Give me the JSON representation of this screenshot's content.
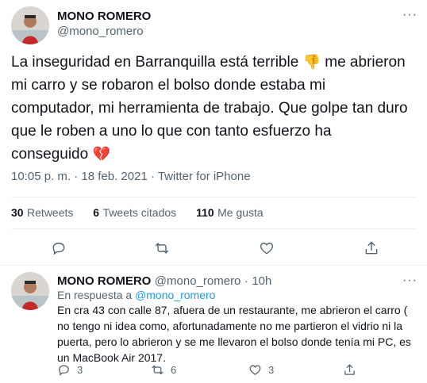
{
  "main_tweet": {
    "author_name": "MONO ROMERO",
    "author_handle": "@mono_romero",
    "text_part1": "La inseguridad en Barranquilla está terrible ",
    "emoji1": "👎",
    "text_part2": " me abrieron mi carro y se robaron el bolso donde estaba mi computador,  mi herramienta de trabajo. Que golpe tan duro que le roben a uno lo que con tanto esfuerzo ha conseguido ",
    "emoji2": "💔",
    "timestamp": "10:05 p. m. · 18 feb. 2021 · Twitter for iPhone",
    "stats": {
      "retweets_count": "30",
      "retweets_label": "Retweets",
      "quotes_count": "6",
      "quotes_label": "Tweets citados",
      "likes_count": "110",
      "likes_label": "Me gusta"
    },
    "more_icon": "more-dots-icon"
  },
  "reply_tweet": {
    "author_name": "MONO ROMERO",
    "author_handle": "@mono_romero",
    "separator": "·",
    "time": "10h",
    "reply_prefix": "En respuesta a ",
    "reply_to": "@mono_romero",
    "text": "En cra 43 con calle 87, afuera de un restaurante, me abrieron el carro ( no tengo ni idea como, afortunadamente no me partieron el vidrio ni la puerta, pero lo abrieron y se me llevaron el bolso donde tenía mi PC, es un MacBook Air 2017.",
    "reply_count": "3",
    "retweet_count": "6",
    "like_count": "3"
  },
  "colors": {
    "text": "#0f1419",
    "secondary": "#536471",
    "link": "#1d9bf0",
    "divider": "#eff3f4"
  }
}
